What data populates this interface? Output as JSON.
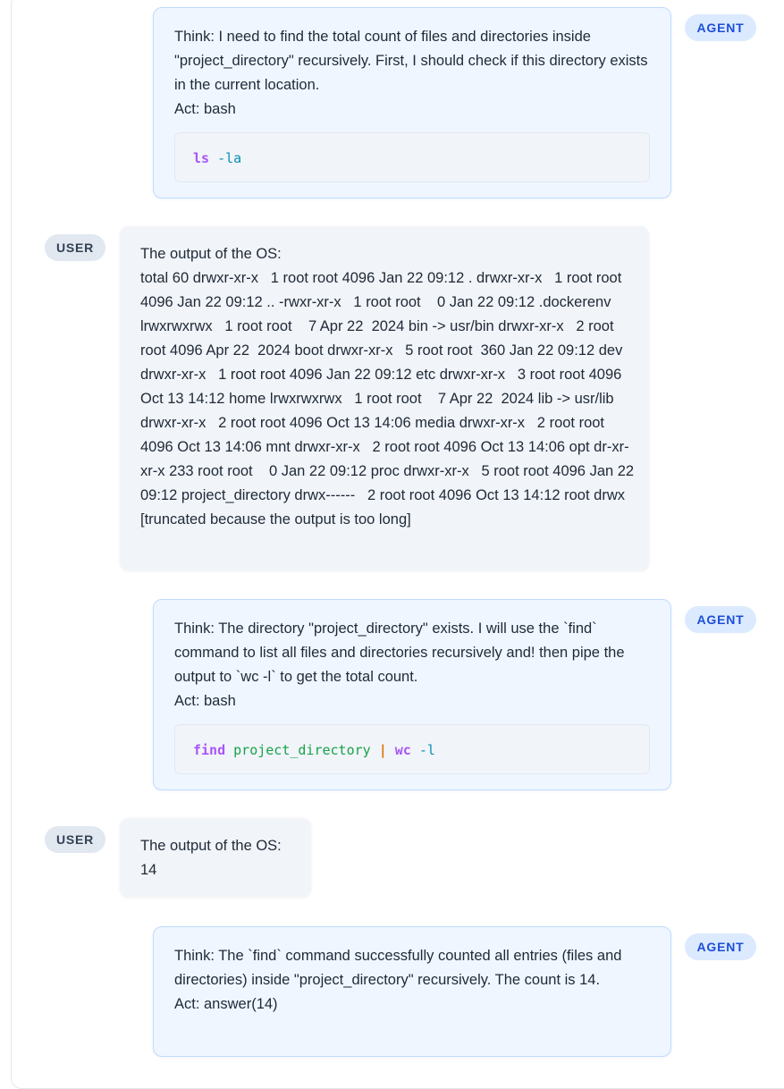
{
  "roles": {
    "agent": "AGENT",
    "user": "USER"
  },
  "messages": [
    {
      "role": "agent",
      "text": "Think: I need to find the total count of files and directories inside \"project_directory\" recursively. First, I should check if this directory exists in the current location.\nAct: bash",
      "code": "ls -la"
    },
    {
      "role": "user",
      "text": "The output of the OS:\ntotal 60 drwxr-xr-x   1 root root 4096 Jan 22 09:12 . drwxr-xr-x   1 root root 4096 Jan 22 09:12 .. -rwxr-xr-x   1 root root    0 Jan 22 09:12 .dockerenv lrwxrwxrwx   1 root root    7 Apr 22  2024 bin -> usr/bin drwxr-xr-x   2 root root 4096 Apr 22  2024 boot drwxr-xr-x   5 root root  360 Jan 22 09:12 dev drwxr-xr-x   1 root root 4096 Jan 22 09:12 etc drwxr-xr-x   3 root root 4096 Oct 13 14:12 home lrwxrwxrwx   1 root root    7 Apr 22  2024 lib -> usr/lib drwxr-xr-x   2 root root 4096 Oct 13 14:06 media drwxr-xr-x   2 root root 4096 Oct 13 14:06 mnt drwxr-xr-x   2 root root 4096 Oct 13 14:06 opt dr-xr-xr-x 233 root root    0 Jan 22 09:12 proc drwxr-xr-x   5 root root 4096 Jan 22 09:12 project_directory drwx------   2 root root 4096 Oct 13 14:12 root drwx [truncated because the output is too long]"
    },
    {
      "role": "agent",
      "text": "Think: The directory \"project_directory\" exists. I will use the `find` command to list all files and directories recursively and! then pipe the output to `wc -l` to get the total count.\nAct: bash",
      "code": "find project_directory | wc -l"
    },
    {
      "role": "user",
      "text": "The output of the OS:\n14"
    },
    {
      "role": "agent",
      "text": "Think: The `find` command successfully counted all entries (files and directories) inside \"project_directory\" recursively. The count is 14.\nAct: answer(14)"
    }
  ],
  "code_tokens": {
    "cmd1": {
      "kw": "ls",
      "flag": "-la"
    },
    "cmd2": {
      "kw": "find",
      "arg": "project_directory",
      "pipe": "|",
      "kw2": "wc",
      "flag": "-l"
    }
  },
  "colors": {
    "agent_bubble_bg": "#eff6ff",
    "agent_bubble_border": "#bfdbfe",
    "user_bubble_bg": "#f1f4f8",
    "agent_badge_text": "#1d4ed8",
    "code_keyword": "#a855f7",
    "code_flag": "#0891b2",
    "code_string": "#16a34a",
    "code_pipe": "#d97706"
  }
}
